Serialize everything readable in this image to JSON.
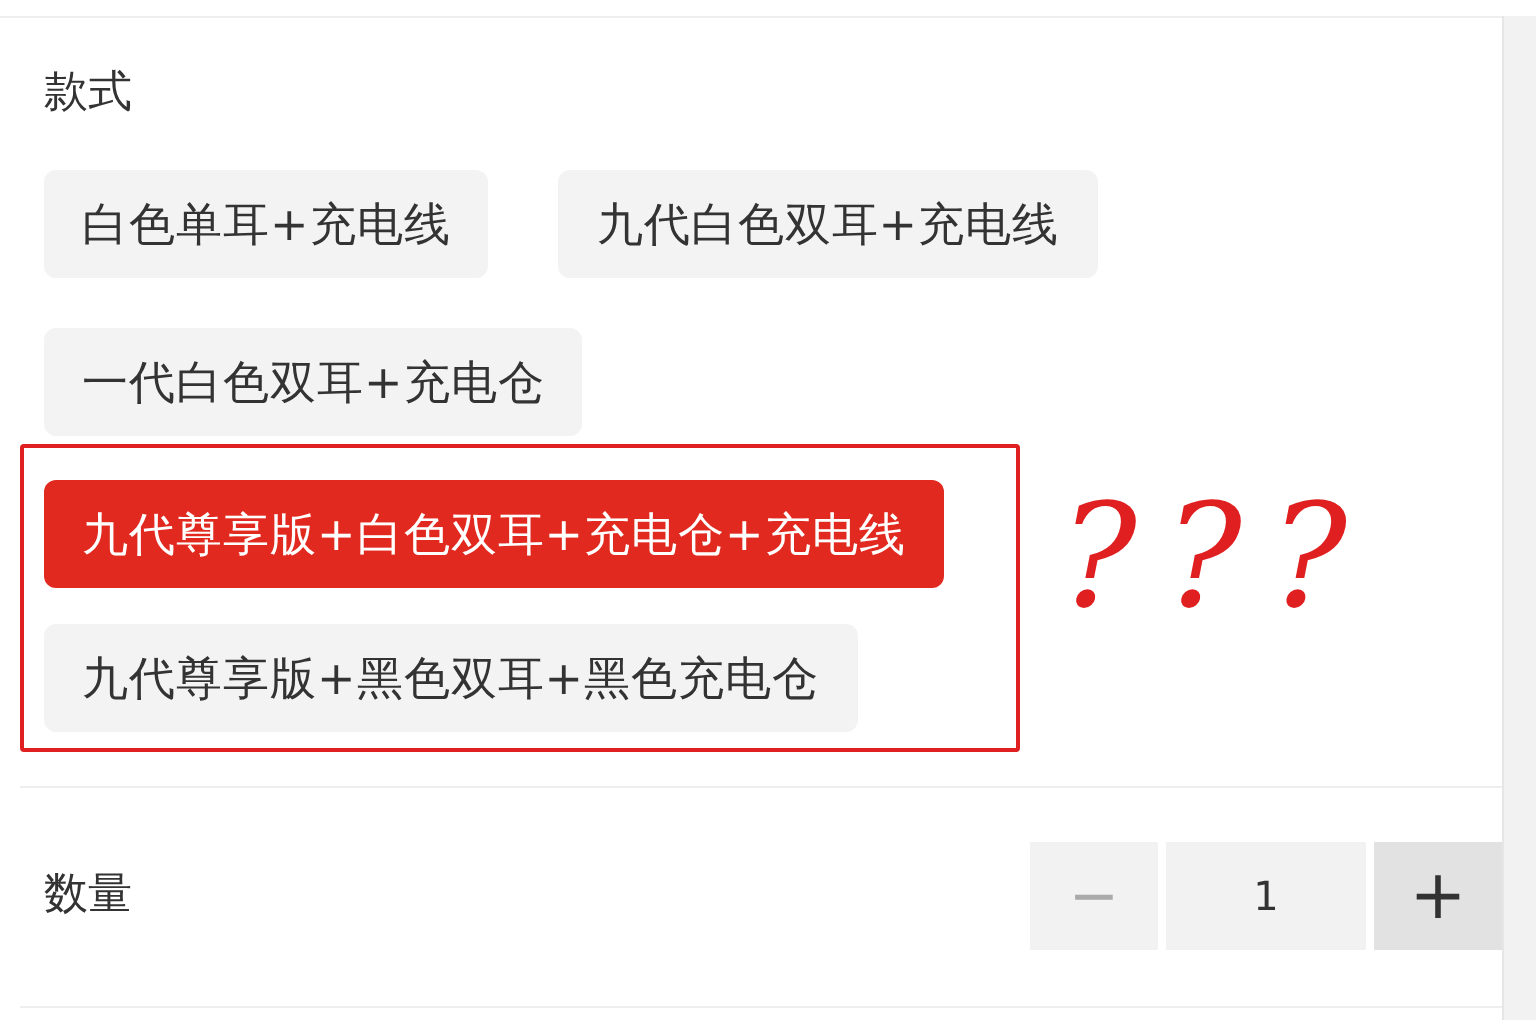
{
  "style": {
    "label": "款式",
    "options": [
      {
        "label": "白色单耳+充电线",
        "selected": false
      },
      {
        "label": "九代白色双耳+充电线",
        "selected": false
      },
      {
        "label": "一代白色双耳+充电仓",
        "selected": false
      }
    ],
    "circled_options": [
      {
        "label": "九代尊享版+白色双耳+充电仓+充电线",
        "selected": true
      },
      {
        "label": "九代尊享版+黑色双耳+黑色充电仓",
        "selected": false
      }
    ]
  },
  "annotation": {
    "text": "???"
  },
  "quantity": {
    "label": "数量",
    "value": "1",
    "buttons": [
      {
        "kind": "minus",
        "glyph": "−",
        "disabled": true
      },
      {
        "kind": "plus",
        "glyph": "+",
        "disabled": false
      }
    ]
  }
}
